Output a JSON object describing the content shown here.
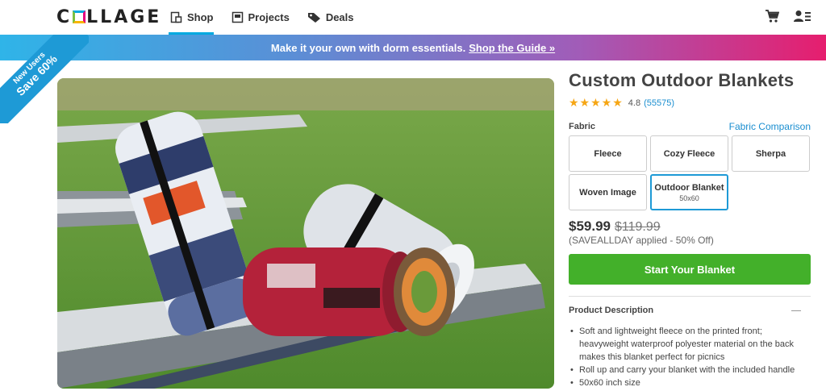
{
  "header": {
    "logo": "COLLAGE",
    "nav": [
      {
        "label": "Shop",
        "icon": "shop-icon",
        "active": true
      },
      {
        "label": "Projects",
        "icon": "projects-icon",
        "active": false
      },
      {
        "label": "Deals",
        "icon": "tag-icon",
        "active": false
      }
    ],
    "icons": [
      "cart-icon",
      "account-icon"
    ]
  },
  "promo": {
    "text": "Make it your own with dorm essentials.",
    "link": "Shop the Guide »"
  },
  "ribbon": {
    "line1": "New Users",
    "line2": "Save 60%"
  },
  "product": {
    "title": "Custom Outdoor Blankets",
    "rating": "4.8",
    "review_count": "(55575)",
    "stars": "★★★★★",
    "fabric_label": "Fabric",
    "fabric_compare": "Fabric Comparison",
    "options": [
      {
        "label": "Fleece",
        "sub": ""
      },
      {
        "label": "Cozy Fleece",
        "sub": ""
      },
      {
        "label": "Sherpa",
        "sub": ""
      },
      {
        "label": "Woven Image",
        "sub": ""
      },
      {
        "label": "Outdoor Blanket",
        "sub": "50x60"
      }
    ],
    "selected_option": "Outdoor Blanket",
    "price_now": "$59.99",
    "price_was": "$119.99",
    "promo_note": "(SAVEALLDAY applied - 50% Off)",
    "cta": "Start Your Blanket",
    "description_heading": "Product Description",
    "description_items": [
      "Soft and lightweight fleece on the printed front; heavyweight waterproof polyester material on the back makes this blanket perfect for picnics",
      "Roll up and carry your blanket with the included handle",
      "50x60 inch size"
    ]
  },
  "colors": {
    "accent": "#00a9e0",
    "cta": "#43b02a",
    "stars": "#f6a614",
    "link": "#1a8ed0"
  }
}
